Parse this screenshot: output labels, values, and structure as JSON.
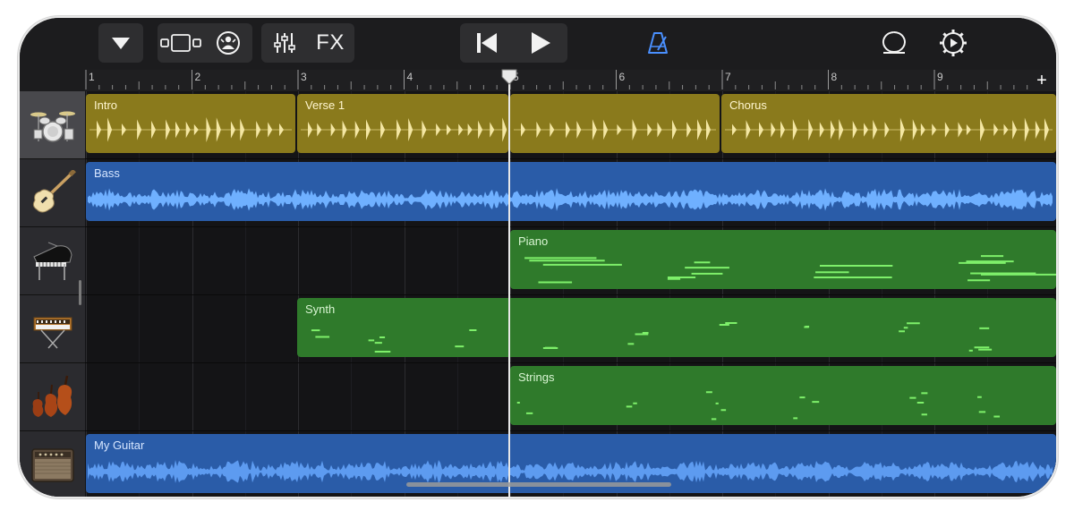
{
  "toolbar": {
    "menu_icon": "triangle-down-icon",
    "views_icon": "track-views-icon",
    "browser_icon": "drummer-browser-icon",
    "mixer_icon": "mixer-sliders-icon",
    "fx_label": "FX",
    "rewind_icon": "go-to-beginning-icon",
    "play_icon": "play-icon",
    "metronome_icon": "metronome-icon",
    "loop_icon": "loop-browser-icon",
    "settings_icon": "settings-gear-icon",
    "accent_color": "#4a90ff"
  },
  "ruler": {
    "bars": [
      "1",
      "2",
      "3",
      "4",
      "5",
      "6",
      "7",
      "8",
      "9"
    ],
    "add_section_label": "+"
  },
  "tracks": [
    {
      "instrument": "drum-kit",
      "regions": [
        {
          "name": "Intro"
        },
        {
          "name": "Verse 1"
        },
        {
          "name": ""
        },
        {
          "name": "Chorus"
        }
      ]
    },
    {
      "instrument": "bass-guitar",
      "regions": [
        {
          "name": "Bass"
        }
      ]
    },
    {
      "instrument": "grand-piano",
      "regions": [
        {
          "name": "Piano"
        }
      ]
    },
    {
      "instrument": "synth-keyboard",
      "regions": [
        {
          "name": "Synth"
        }
      ]
    },
    {
      "instrument": "strings",
      "regions": [
        {
          "name": "Strings"
        }
      ]
    },
    {
      "instrument": "guitar-amp",
      "regions": [
        {
          "name": "My Guitar"
        }
      ]
    }
  ],
  "colors": {
    "drummer_region": "#8a7a1c",
    "audio_region": "#2a5ca8",
    "midi_region": "#2f7a2b",
    "playhead": "#e8e8e8"
  }
}
